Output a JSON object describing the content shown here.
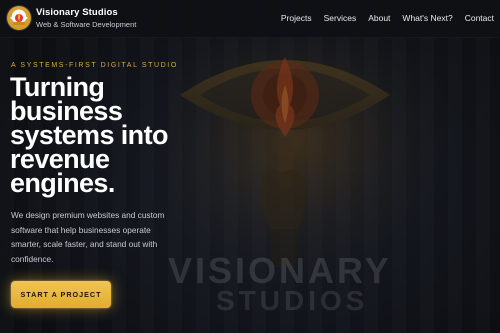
{
  "header": {
    "brand_name": "Visionary Studios",
    "brand_tagline": "Web & Software Development",
    "logo_icon": "eye-flame-logo-icon"
  },
  "nav": {
    "items": [
      {
        "label": "Projects"
      },
      {
        "label": "Services"
      },
      {
        "label": "About"
      },
      {
        "label": "What's Next?"
      },
      {
        "label": "Contact"
      }
    ]
  },
  "hero": {
    "kicker": "A SYSTEMS-FIRST DIGITAL STUDIO",
    "headline_lines": [
      "Turning",
      "business",
      "systems into",
      "revenue",
      "engines."
    ],
    "subcopy": "We design premium websites and custom software that help businesses operate smarter, scale faster, and stand out with confidence.",
    "cta_label": "START A PROJECT",
    "background_art": "eye-and-torch-icon",
    "watermark_line1": "VISIONARY",
    "watermark_line2": "STUDIOS"
  },
  "colors": {
    "accent": "#e2ad2f",
    "kicker": "#d8a947",
    "background": "#12151b",
    "text": "#ffffff"
  }
}
